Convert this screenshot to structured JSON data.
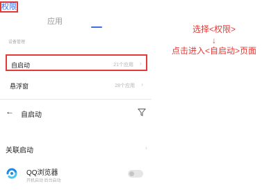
{
  "tabs": {
    "apps": "应用",
    "permissions": "权限"
  },
  "section_label": "设备管理",
  "rows": [
    {
      "label": "自启动",
      "count": "21个应用"
    },
    {
      "label": "悬浮窗",
      "count": "28个应用"
    }
  ],
  "annotation": {
    "line1": "选择<权限>",
    "arrow": "↓",
    "line2": "点击进入<自启动>页面"
  },
  "detail": {
    "title": "自启动",
    "assoc_label": "关联启动",
    "app": {
      "name": "QQ浏览器",
      "sub": "开机启动  后台启动",
      "toggle_on": false
    }
  },
  "colors": {
    "highlight": "#e53935",
    "accent": "#3d6fe0"
  },
  "icons": {
    "back": "back-arrow-icon",
    "filter": "filter-icon",
    "chevron": "chevron-right-icon",
    "app": "qq-browser-icon"
  }
}
